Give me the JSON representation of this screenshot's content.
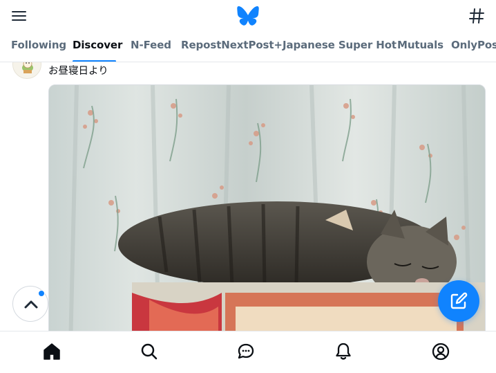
{
  "header": {
    "menu_icon": "hamburger-menu-icon",
    "logo_icon": "butterfly-logo-icon",
    "right_icon": "hashtag-icon"
  },
  "tabs": [
    {
      "label": "Following",
      "active": false
    },
    {
      "label": "Discover",
      "active": true
    },
    {
      "label": "N-Feed",
      "active": false
    },
    {
      "label": "RepostNextPost+",
      "active": false
    },
    {
      "label": "Japanese Super Hot",
      "active": false
    },
    {
      "label": "Mutuals",
      "active": false
    },
    {
      "label": "OnlyPosts",
      "active": false
    }
  ],
  "post": {
    "text": "お昼寝日より",
    "image_icon": "sleeping-cat-photo"
  },
  "floating": {
    "scroll_top_icon": "chevron-up-icon",
    "compose_icon": "compose-pencil-icon"
  },
  "bottom_nav": [
    {
      "icon": "home-icon",
      "active": true
    },
    {
      "icon": "search-icon",
      "active": false
    },
    {
      "icon": "chat-icon",
      "active": false
    },
    {
      "icon": "bell-icon",
      "active": false
    },
    {
      "icon": "profile-icon",
      "active": false
    }
  ],
  "colors": {
    "accent": "#1083fe",
    "text": "#0b0f14",
    "muted": "#5b6b7b"
  }
}
